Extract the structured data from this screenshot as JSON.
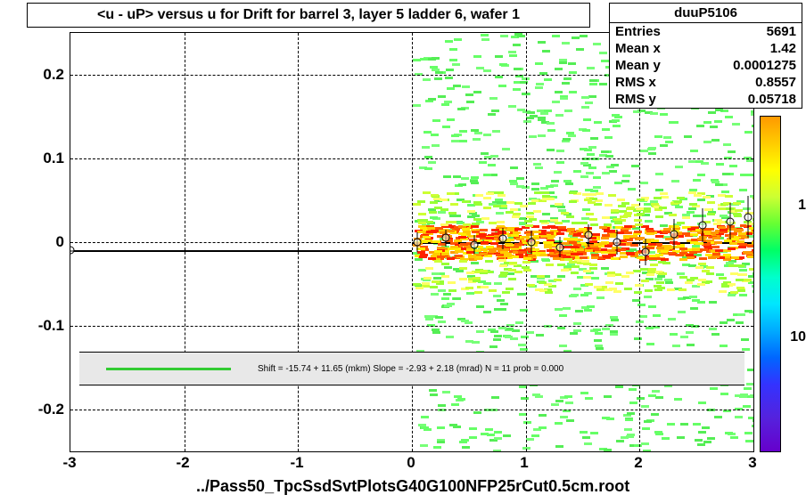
{
  "title": "<u - uP>       versus   u for Drift for barrel 3, layer 5 ladder 6, wafer 1",
  "stats": {
    "name": "duuP5106",
    "entries_label": "Entries",
    "entries": "5691",
    "meanx_label": "Mean x",
    "meanx": "1.42",
    "meany_label": "Mean y",
    "meany": "0.0001275",
    "rmsx_label": "RMS x",
    "rmsx": "0.8557",
    "rmsy_label": "RMS y",
    "rmsy": "0.05718"
  },
  "fit_text": "Shift =   -15.74 +  11.65 (mkm) Slope =    -2.93 +  2.18 (mrad)   N = 11 prob = 0.000",
  "footer": "../Pass50_TpcSsdSvtPlotsG40G100NFP25rCut0.5cm.root",
  "colorbar": {
    "tick1": "1",
    "tick2": "10"
  },
  "chart_data": {
    "type": "heatmap",
    "title": "<u - uP> versus u for Drift for barrel 3, layer 5 ladder 6, wafer 1",
    "xlabel": "u",
    "ylabel": "<u - uP>",
    "xlim": [
      -3,
      3
    ],
    "ylim": [
      -0.25,
      0.25
    ],
    "zscale": "log",
    "zlim": [
      0.3,
      10
    ],
    "xticks": [
      -3,
      -2,
      -1,
      0,
      1,
      2,
      3
    ],
    "yticks": [
      -0.2,
      -0.1,
      0,
      0.1,
      0.2
    ],
    "fit": {
      "shift_mkm": -15.74,
      "shift_err_mkm": 11.65,
      "slope_mrad": -2.93,
      "slope_err_mrad": 2.18,
      "N": 11,
      "prob": 0.0
    },
    "profile_points": [
      {
        "x": -3.0,
        "y": -0.01,
        "ey": 0.0
      },
      {
        "x": 0.05,
        "y": 0.0,
        "ey": 0.012
      },
      {
        "x": 0.3,
        "y": 0.005,
        "ey": 0.01
      },
      {
        "x": 0.55,
        "y": -0.003,
        "ey": 0.011
      },
      {
        "x": 0.8,
        "y": 0.004,
        "ey": 0.013
      },
      {
        "x": 1.05,
        "y": 0.0,
        "ey": 0.014
      },
      {
        "x": 1.3,
        "y": -0.006,
        "ey": 0.012
      },
      {
        "x": 1.55,
        "y": 0.008,
        "ey": 0.013
      },
      {
        "x": 1.8,
        "y": 0.0,
        "ey": 0.015
      },
      {
        "x": 2.05,
        "y": -0.012,
        "ey": 0.016
      },
      {
        "x": 2.3,
        "y": 0.01,
        "ey": 0.018
      },
      {
        "x": 2.55,
        "y": 0.02,
        "ey": 0.02
      },
      {
        "x": 2.8,
        "y": 0.025,
        "ey": 0.022
      },
      {
        "x": 2.95,
        "y": 0.03,
        "ey": 0.025
      }
    ],
    "density_note": "2D histogram bins concentrated in x∈[0,3], y∈[-0.1,0.1]; highest counts (red/orange) near y≈0; sparse green dashes scattered throughout x∈[0,3], y∈[-0.25,0.25]."
  },
  "axis": {
    "x": {
      "m3": "-3",
      "m2": "-2",
      "m1": "-1",
      "z": "0",
      "p1": "1",
      "p2": "2",
      "p3": "3"
    },
    "y": {
      "m2": "-0.2",
      "m1": "-0.1",
      "z": "0",
      "p1": "0.1",
      "p2": "0.2"
    }
  }
}
